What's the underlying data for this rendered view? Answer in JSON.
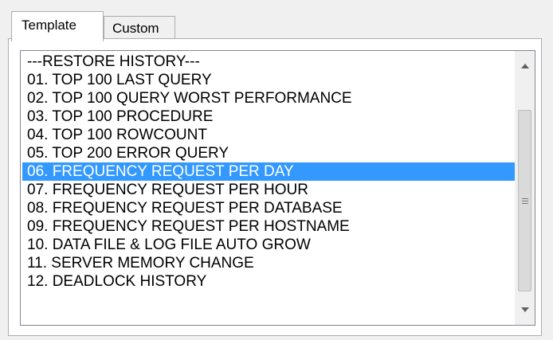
{
  "tabs": [
    {
      "label": "Template",
      "active": true
    },
    {
      "label": "Custom",
      "active": false
    }
  ],
  "list": {
    "items": [
      "---RESTORE HISTORY---",
      "01. TOP 100 LAST QUERY",
      "02. TOP 100 QUERY WORST PERFORMANCE",
      "03. TOP 100 PROCEDURE",
      "04. TOP 100 ROWCOUNT",
      "05. TOP 200 ERROR QUERY",
      "06. FREQUENCY REQUEST PER DAY",
      "07. FREQUENCY REQUEST PER HOUR",
      "08. FREQUENCY REQUEST PER DATABASE",
      "09. FREQUENCY REQUEST PER HOSTNAME",
      "10. DATA FILE & LOG FILE AUTO GROW",
      "11. SERVER MEMORY CHANGE",
      "12. DEADLOCK HISTORY"
    ],
    "selected_index": 6
  },
  "scrollbar": {
    "up_icon": "chevron-up-icon",
    "down_icon": "chevron-down-icon",
    "grip_icon": "grip-icon"
  },
  "colors": {
    "selection": "#3399ff",
    "selection_text": "#ffffff",
    "border": "#adadad"
  }
}
